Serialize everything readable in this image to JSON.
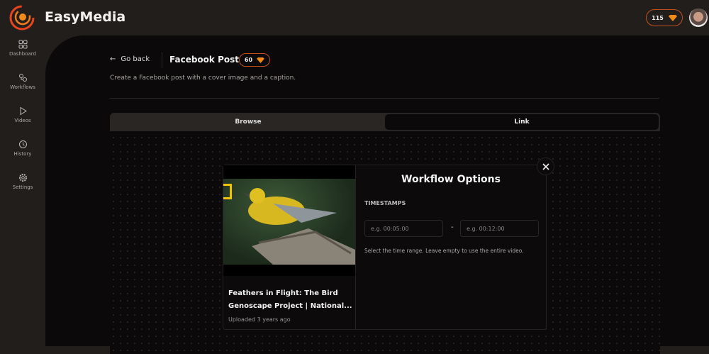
{
  "app": {
    "name": "EasyMedia",
    "credits": "115",
    "accent": "#f07a1a"
  },
  "sidebar": {
    "items": [
      {
        "label": "Dashboard",
        "icon": "grid-icon"
      },
      {
        "label": "Workflows",
        "icon": "workflow-icon"
      },
      {
        "label": "Videos",
        "icon": "play-icon"
      },
      {
        "label": "History",
        "icon": "history-icon"
      },
      {
        "label": "Settings",
        "icon": "gear-icon"
      }
    ]
  },
  "header": {
    "back_label": "Go back",
    "title": "Facebook Post",
    "cost": "60",
    "description": "Create a Facebook post with a cover image and a caption."
  },
  "tabs": [
    {
      "label": "Browse",
      "active": false
    },
    {
      "label": "Link",
      "active": true
    }
  ],
  "video": {
    "title": "Feathers in Flight: The Bird Genoscape Project | National...",
    "uploaded": "Uploaded 3 years ago"
  },
  "modal": {
    "title": "Workflow Options",
    "section_label": "TIMESTAMPS",
    "start_placeholder": "e.g. 00:05:00",
    "end_placeholder": "e.g. 00:12:00",
    "separator": "-",
    "help": "Select the time range. Leave empty to use the entire video."
  }
}
